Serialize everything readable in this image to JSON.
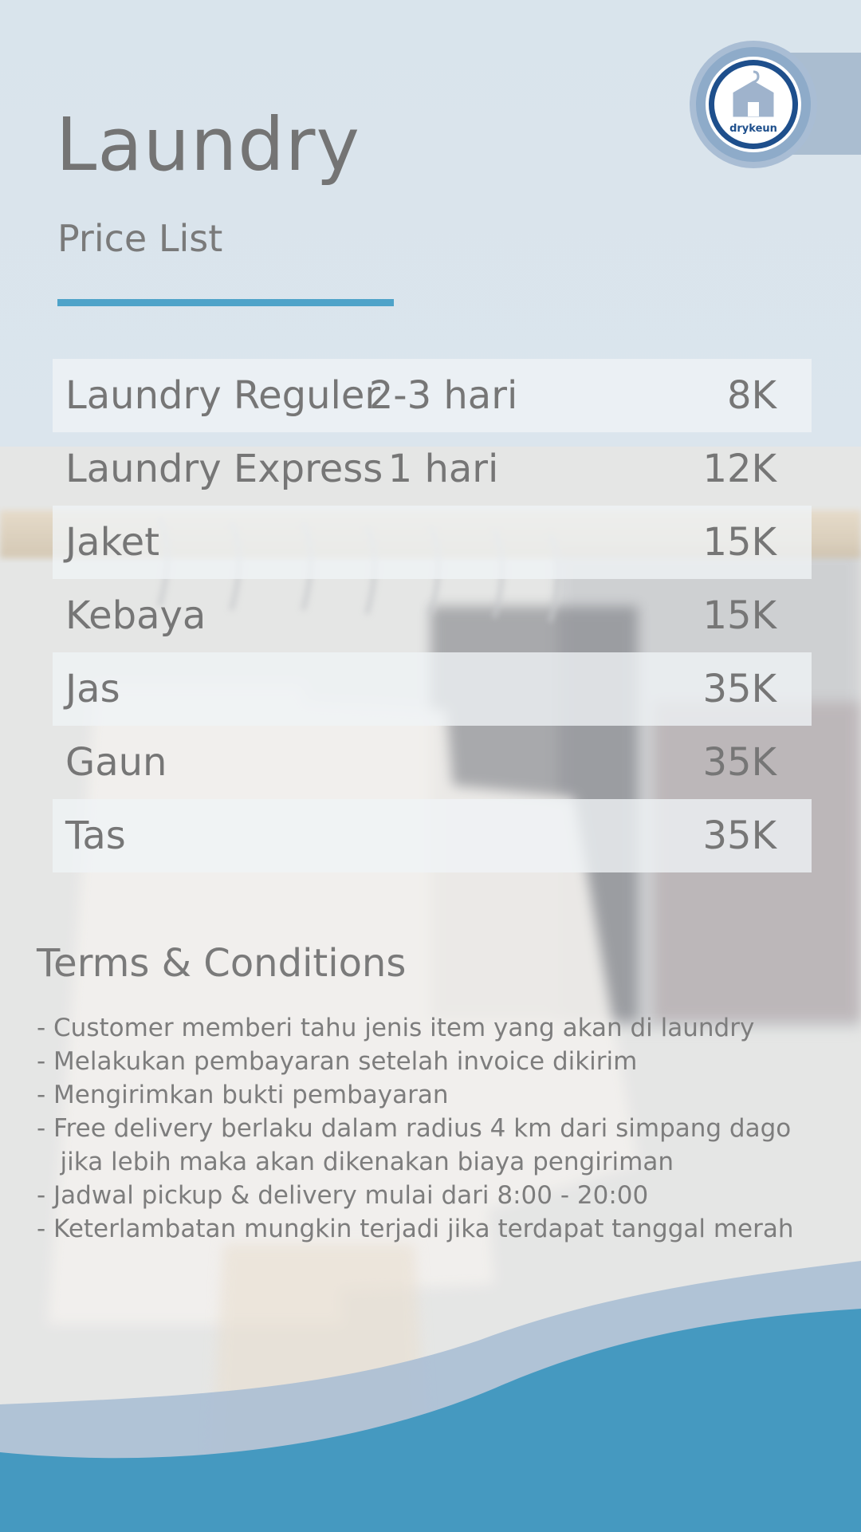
{
  "header": {
    "title": "Laundry",
    "subtitle": "Price List",
    "logo_text": "drykeun"
  },
  "prices": [
    {
      "name": "Laundry Reguler",
      "duration": "2-3 hari",
      "price": "8K"
    },
    {
      "name": "Laundry Express",
      "duration": "1 hari",
      "price": "12K"
    },
    {
      "name": "Jaket",
      "duration": "",
      "price": "15K"
    },
    {
      "name": "Kebaya",
      "duration": "",
      "price": "15K"
    },
    {
      "name": "Jas",
      "duration": "",
      "price": "35K"
    },
    {
      "name": "Gaun",
      "duration": "",
      "price": "35K"
    },
    {
      "name": "Tas",
      "duration": "",
      "price": "35K"
    }
  ],
  "terms": {
    "title": "Terms & Conditions",
    "items": [
      "- Customer memberi tahu jenis item yang akan di laundry",
      "- Melakukan pembayaran setelah invoice dikirim",
      "- Mengirimkan bukti pembayaran",
      "- Free delivery berlaku dalam radius 4 km dari simpang dago",
      "   jika lebih maka akan dikenakan biaya pengiriman",
      "- Jadwal pickup & delivery mulai dari 8:00 - 20:00",
      "- Keterlambatan mungkin terjadi jika terdapat tanggal merah"
    ]
  },
  "colors": {
    "accent": "#4ea3c9",
    "wave_dark": "#4599c0",
    "wave_light": "#a7bcd3",
    "text": "#767676",
    "logo_blue": "#1e4f8c"
  },
  "icons": {
    "logo": "house-hanger-badge-icon"
  }
}
